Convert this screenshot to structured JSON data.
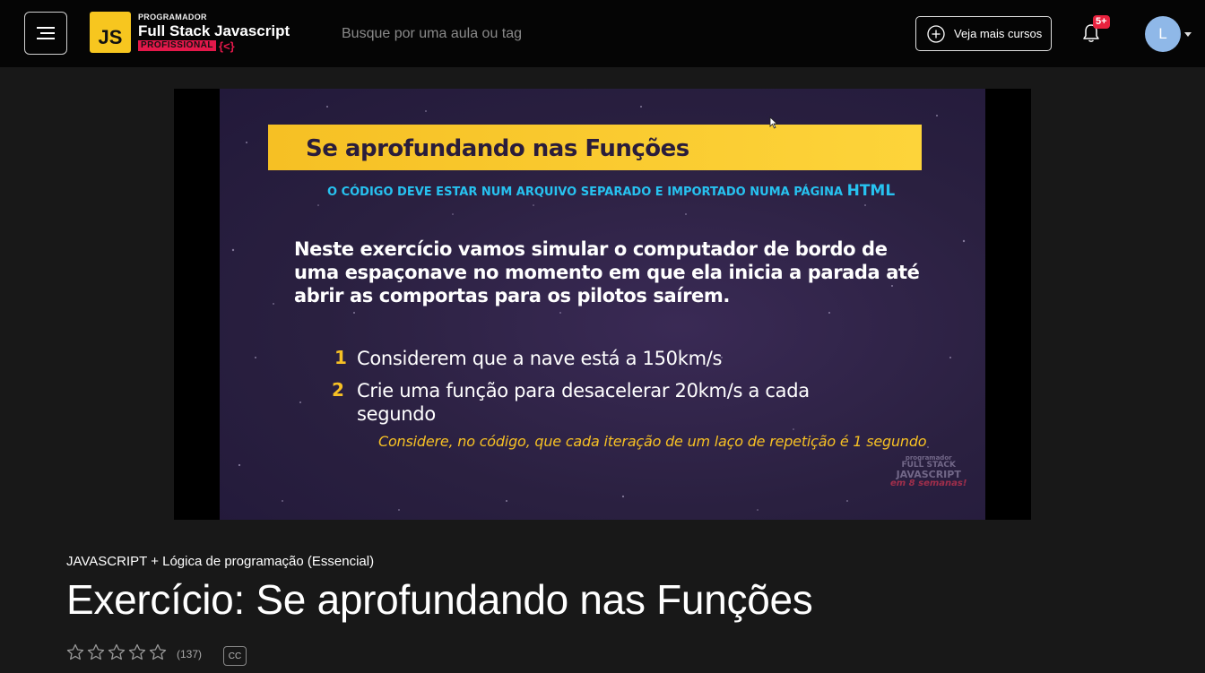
{
  "header": {
    "logo": {
      "badge": "JS",
      "small": "PROGRAMADOR",
      "big": "Full Stack Javascript",
      "tag": "PROFISSIONAL",
      "brace": "{<}"
    },
    "search_placeholder": "Busque por uma aula ou tag",
    "courses_button": "Veja mais cursos",
    "notifications_badge": "5+",
    "avatar_initial": "L"
  },
  "video": {
    "slide_title": "Se aprofundando nas Funções",
    "slide_subtitle_prefix": "O CÓDIGO DEVE ESTAR NUM ARQUIVO SEPARADO E IMPORTADO NUMA PÁGINA",
    "slide_subtitle_emph": "HTML",
    "slide_paragraph": "Neste exercício vamos simular o computador de bordo de uma espaçonave no momento em que ela inicia a parada até abrir as comportas para os pilotos saírem.",
    "items": [
      {
        "num": "1",
        "text": "Considerem que a nave está a 150km/s"
      },
      {
        "num": "2",
        "text": "Crie uma função para desacelerar 20km/s a cada segundo"
      }
    ],
    "note": "Considere, no código, que cada iteração de um laço de repetição é 1 segundo",
    "watermark": {
      "line1": "programador",
      "line2": "FULL STACK",
      "line3": "JAVASCRIPT",
      "line4": "em 8 semanas!"
    }
  },
  "lesson": {
    "course": "JAVASCRIPT + Lógica de programação (Essencial)",
    "title": "Exercício: Se aprofundando nas Funções",
    "rating_count": "(137)",
    "cc": "CC"
  },
  "colors": {
    "accent_yellow": "#f6c024",
    "subtitle_blue": "#27c2f0",
    "badge_red": "#e8223e",
    "avatar_blue": "#8fb8e8"
  }
}
